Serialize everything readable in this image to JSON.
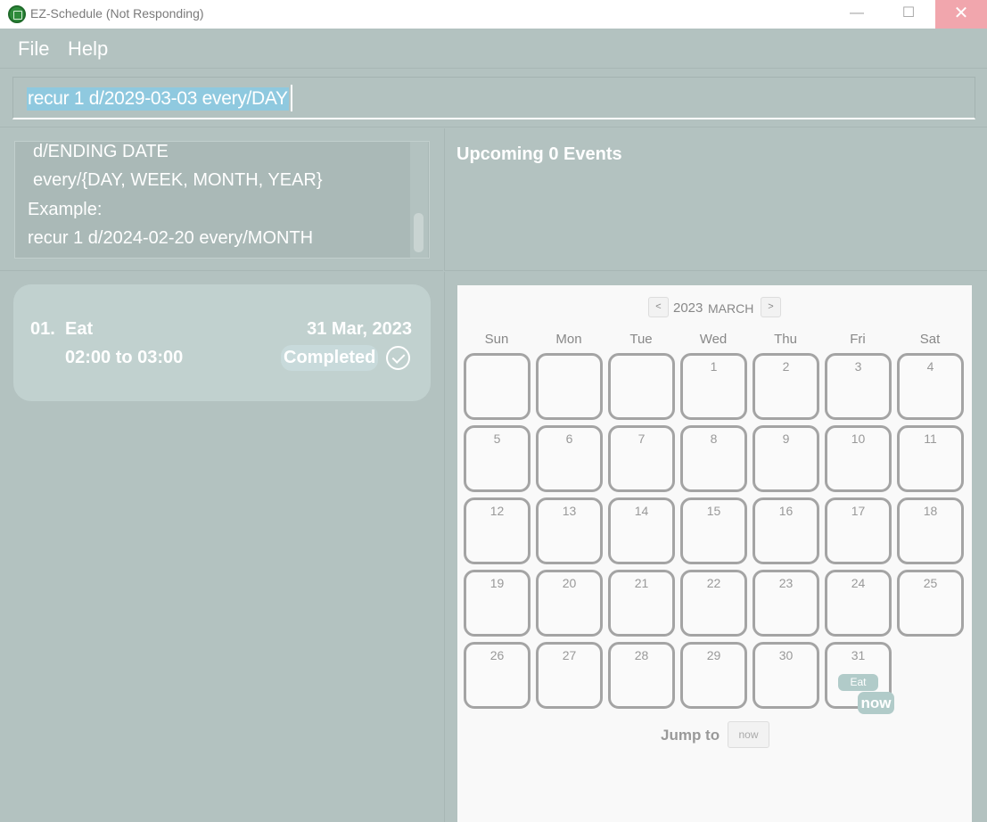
{
  "window": {
    "title": "EZ-Schedule (Not Responding)",
    "controls": {
      "minimize": "—",
      "maximize": "☐",
      "close": "✕"
    }
  },
  "menu": {
    "file": "File",
    "help": "Help"
  },
  "command": {
    "value": "recur 1 d/2029-03-03 every/DAY"
  },
  "result": {
    "lines": [
      "d/ENDING DATE",
      "every/{DAY, WEEK, MONTH, YEAR}",
      "Example:",
      "recur 1 d/2024-02-20 every/MONTH"
    ]
  },
  "upcoming": {
    "title": "Upcoming 0 Events"
  },
  "events": [
    {
      "index": "01.",
      "name": "Eat",
      "date": "31 Mar, 2023",
      "time": "02:00 to 03:00",
      "status": "Completed",
      "status_icon": "check-circle-icon"
    }
  ],
  "calendar": {
    "prev": "<",
    "next": ">",
    "year": "2023",
    "month": "MARCH",
    "weekdays": [
      "Sun",
      "Mon",
      "Tue",
      "Wed",
      "Thu",
      "Fri",
      "Sat"
    ],
    "first_weekday_index": 3,
    "days_in_month": 31,
    "event_day": 31,
    "event_label": "Eat",
    "now_label": "now",
    "jump_label": "Jump to",
    "jump_button": "now"
  }
}
